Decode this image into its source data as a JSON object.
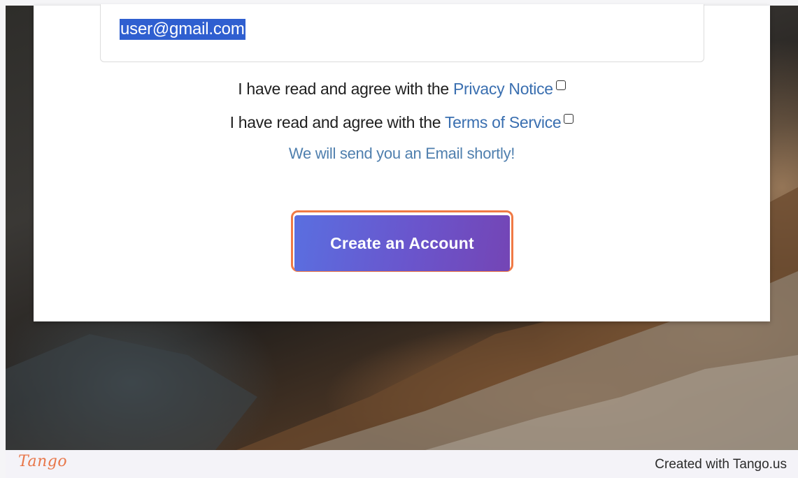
{
  "form": {
    "email_value": "user@gmail.com",
    "privacy_prefix": "I have read and agree with the ",
    "privacy_link": "Privacy Notice",
    "terms_prefix": "I have read and agree with the ",
    "terms_link": "Terms of Service",
    "notice": "We will send you an Email shortly!",
    "submit_label": "Create an Account"
  },
  "footer": {
    "logo": "Tango",
    "credit": "Created with Tango.us"
  },
  "colors": {
    "highlight": "#f07a45",
    "link": "#3a6fb0",
    "button_start": "#5a6fe0",
    "button_end": "#7445b5"
  }
}
